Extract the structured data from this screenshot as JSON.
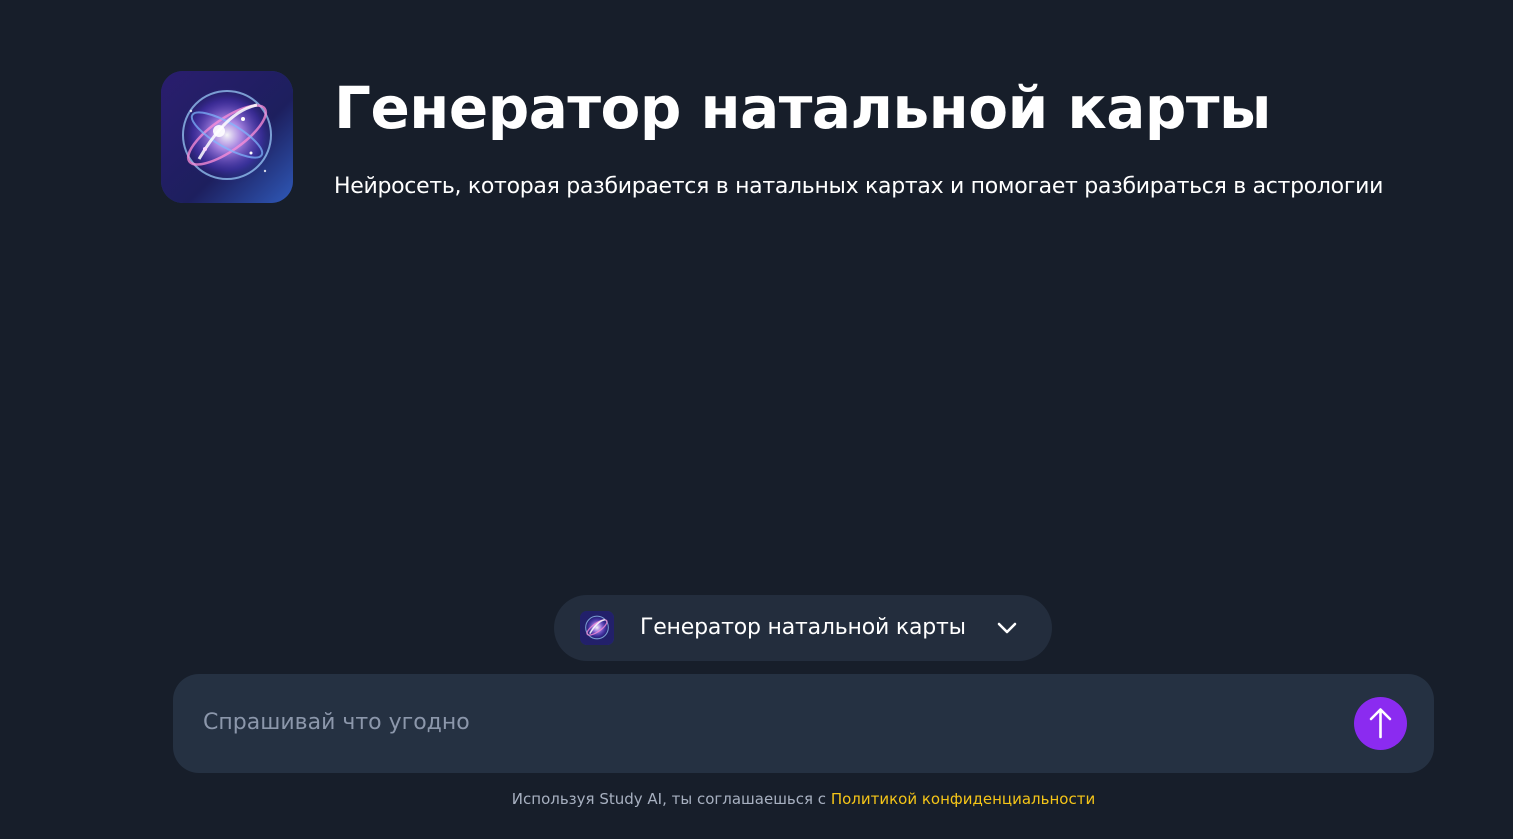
{
  "hero": {
    "title": "Генератор натальной карты",
    "subtitle": "Нейросеть, которая разбирается в натальных картах и помогает разбираться в астрологии",
    "icon": "cosmic-sphere-icon"
  },
  "agent_selector": {
    "label": "Генератор натальной карты",
    "icon": "cosmic-sphere-icon",
    "dropdown_icon": "chevron-down-icon"
  },
  "chat": {
    "placeholder": "Спрашивай что угодно",
    "value": "",
    "send_icon": "arrow-up-icon"
  },
  "footer": {
    "text": "Используя Study AI, ты соглашаешься с",
    "link_text": "Политикой конфиденциальности"
  },
  "colors": {
    "background": "#171e2a",
    "panel": "#253142",
    "selector": "#232d3d",
    "accent": "#8b2bf0",
    "link": "#f5c518",
    "muted_text": "#a7b0c0",
    "placeholder": "#8c97ab"
  }
}
